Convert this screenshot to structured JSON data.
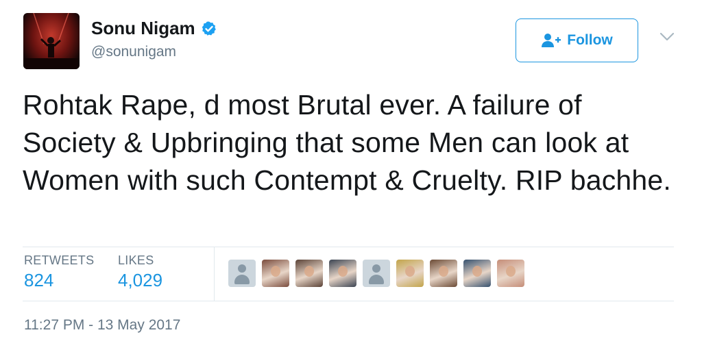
{
  "user": {
    "display_name": "Sonu Nigam",
    "handle": "@sonunigam",
    "verified": true
  },
  "follow_button": {
    "label": "Follow",
    "icon": "add-user-icon"
  },
  "menu_caret": {
    "icon": "chevron-down-icon"
  },
  "tweet": {
    "text": "Rohtak Rape, d most Brutal ever. A failure of Society & Upbringing that some Men can look at Women with such Contempt & Cruelty. RIP bachhe."
  },
  "stats": {
    "retweets_label": "RETWEETS",
    "retweets_value": "824",
    "likes_label": "LIKES",
    "likes_value": "4,029"
  },
  "likers": [
    {
      "kind": "default"
    },
    {
      "kind": "photo",
      "color": "#7a4b3c"
    },
    {
      "kind": "photo",
      "color": "#5a4236"
    },
    {
      "kind": "photo",
      "color": "#3b4452"
    },
    {
      "kind": "default"
    },
    {
      "kind": "photo",
      "color": "#c2a44a"
    },
    {
      "kind": "photo",
      "color": "#6b4a35"
    },
    {
      "kind": "photo",
      "color": "#35506e"
    },
    {
      "kind": "photo",
      "color": "#c58d78"
    }
  ],
  "timestamp": "11:27 PM - 13 May 2017",
  "colors": {
    "accent": "#1b95e0",
    "secondary_text": "#657786",
    "divider": "#e1e8ed"
  }
}
